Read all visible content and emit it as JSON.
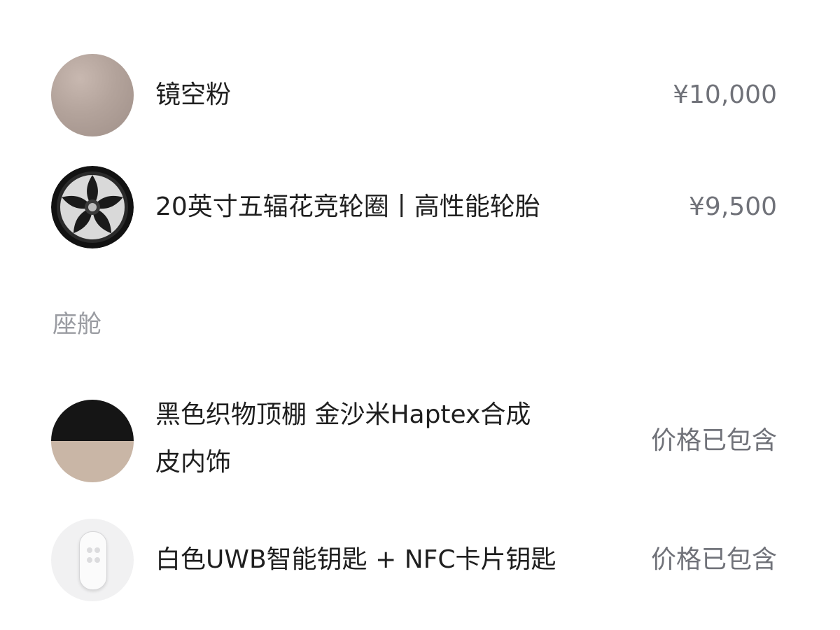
{
  "items": [
    {
      "name": "镜空粉",
      "price": "¥10,000",
      "icon": "paint-swatch"
    },
    {
      "name": "20英寸五辐花竞轮圈丨高性能轮胎",
      "price": "¥9,500",
      "icon": "wheel-rim"
    }
  ],
  "sections": [
    {
      "title": "座舱",
      "items": [
        {
          "name_line1": "黑色织物顶棚 金沙米Haptex合成",
          "name_line2": "皮内饰",
          "price": "价格已包含",
          "icon": "interior-swatch"
        },
        {
          "name": "白色UWB智能钥匙 + NFC卡片钥匙",
          "price": "价格已包含",
          "icon": "smart-key"
        }
      ]
    }
  ],
  "colors": {
    "text_primary": "#1f1f1f",
    "text_price": "#707279",
    "text_section": "#9a9ca2"
  }
}
